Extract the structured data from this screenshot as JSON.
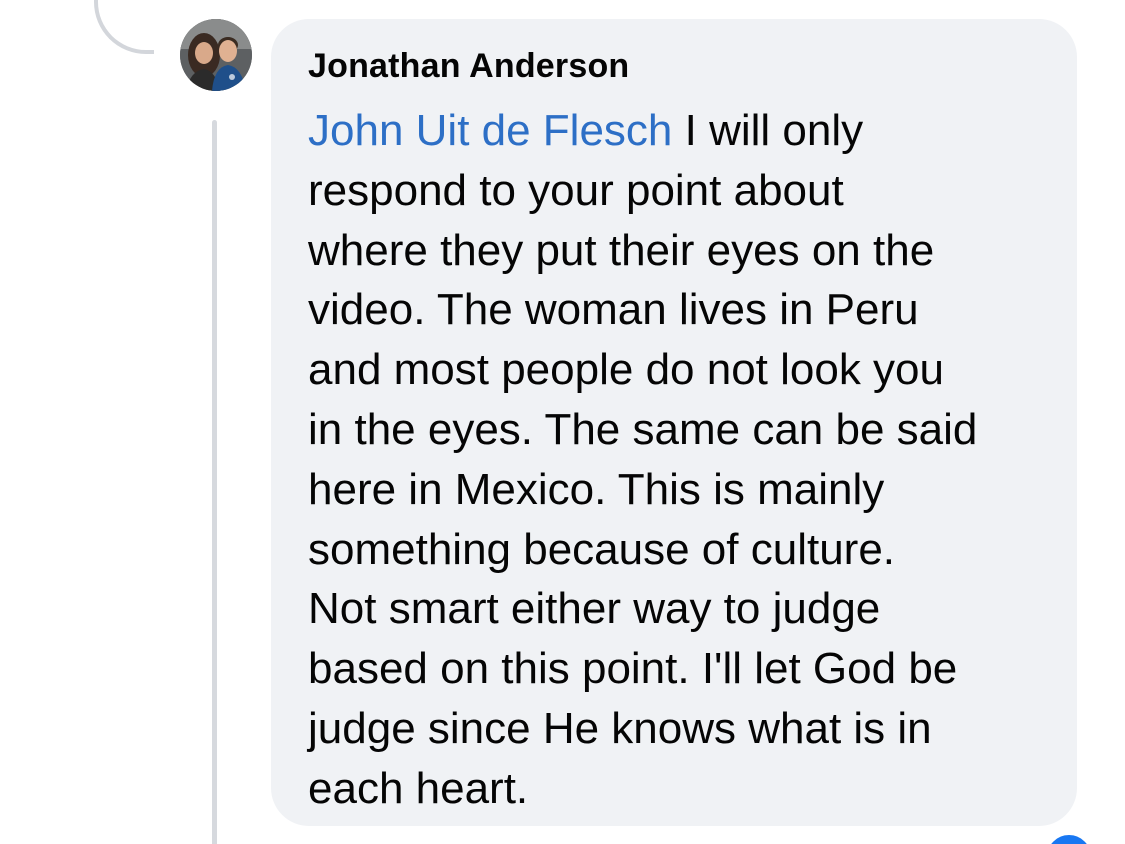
{
  "comment": {
    "author": "Jonathan Anderson",
    "mention": "John Uit de Flesch",
    "first_line_rest": " I will only",
    "lines": [
      "respond to your point about",
      "where they put their eyes on the",
      "video. The woman lives in Peru",
      "and most people do not look you",
      "in the eyes. The same can be said",
      "here in Mexico. This is mainly",
      "something because of culture.",
      "Not smart either way to judge",
      "based on this point. I'll let God be",
      "judge since He knows what is in",
      "each heart."
    ]
  },
  "icons": {
    "avatar": "profile-photo-couple",
    "reaction": "like-reaction-icon"
  },
  "colors": {
    "bubble_bg": "#f0f2f5",
    "mention": "#2d6fc6",
    "text": "#050505",
    "thread_line": "#d6d9de",
    "reaction": "#1877f2"
  }
}
